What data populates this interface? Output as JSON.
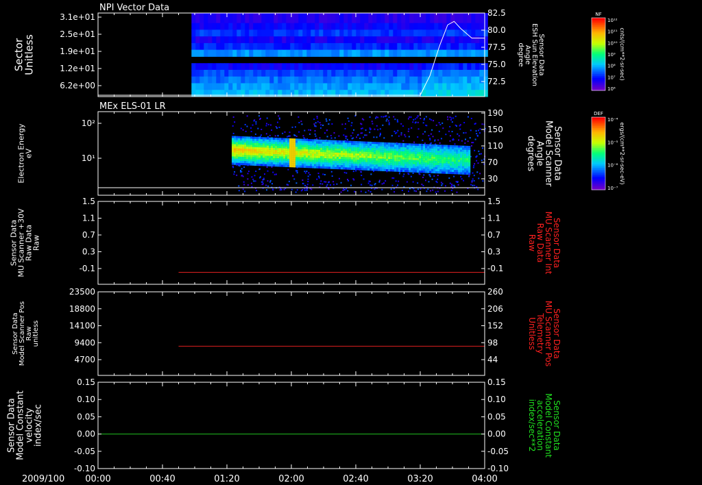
{
  "time_axis": {
    "date_label": "2009/100",
    "ticks": [
      "00:00",
      "00:40",
      "01:20",
      "02:00",
      "02:40",
      "03:20",
      "04:00"
    ]
  },
  "chart_data": [
    {
      "type": "heatmap",
      "title": "NPI Vector Data",
      "ylabel": "Sector\nUnitless",
      "y_ticks": [
        "3.1e+01",
        "2.5e+01",
        "1.9e+01",
        "1.2e+01",
        "6.2e+00"
      ],
      "right_ticks": [
        "82.5",
        "80.0",
        "77.5",
        "75.0",
        "72.5"
      ],
      "right_label": "Sensor Data\nESH Sun Elevation\nAngle\ndegree",
      "ylim_right": [
        70.5,
        82.5
      ],
      "data_start": "00:58",
      "overlay_line": {
        "name": "ESH Sun Elevation Angle",
        "x": [
          "00:00",
          "00:58",
          "03:20",
          "03:26",
          "03:32",
          "03:37",
          "03:41",
          "03:45",
          "03:52",
          "04:00"
        ],
        "y": [
          70.7,
          70.7,
          70.7,
          73.5,
          77.8,
          80.8,
          81.3,
          80.3,
          78.9,
          78.9
        ]
      },
      "colorbar": {
        "label": "NF",
        "units": "cnts/(cm**2-sr-sec)",
        "ticks": [
          "10¹²",
          "10¹¹",
          "10¹⁰",
          "10⁹",
          "10⁸",
          "10⁷",
          "10⁶"
        ]
      }
    },
    {
      "type": "heatmap",
      "title": "MEx ELS-01 LR",
      "ylabel": "Electron Energy\neV",
      "y_ticks": [
        "10²",
        "10¹"
      ],
      "right_ticks": [
        "190",
        "150",
        "110",
        "70",
        "30"
      ],
      "right_label": "Sensor Data\nModel Scanner\nAngle\ndegrees",
      "data_start": "01:23",
      "colorbar": {
        "label": "DEF",
        "units": "ergs/(cm**2-sr-sec-eV)",
        "ticks": [
          "10⁻⁴",
          "10⁻⁵",
          "10⁻⁶",
          "10⁻⁷"
        ]
      }
    },
    {
      "type": "line",
      "ylabel": "Sensor Data\nMU Scanner +30V\nRaw Data\nRaw",
      "y_ticks": [
        "1.5",
        "1.1",
        "0.7",
        "0.3",
        "-0.1"
      ],
      "ylim": [
        -0.3,
        1.5
      ],
      "right_ticks": [
        "1.5",
        "1.1",
        "0.7",
        "0.3",
        "-0.1"
      ],
      "right_label": "Sensor Data\nMU Scanner Int\nRaw Data\nRaw",
      "right_label_color": "#ff2020",
      "series": [
        {
          "color": "#e02020",
          "x": [
            "00:50",
            "04:00"
          ],
          "y": [
            -0.04,
            -0.04
          ]
        }
      ]
    },
    {
      "type": "line",
      "ylabel": "Sensor Data\nModel Scanner Pos\nRaw\nunitless",
      "y_ticks": [
        "23500",
        "18800",
        "14100",
        "9400",
        "4700"
      ],
      "ylim": [
        0,
        23500
      ],
      "right_ticks": [
        "260",
        "206",
        "152",
        "98",
        "44"
      ],
      "right_label": "Sensor Data\nMU Scanner Pos\nTelemetry\nUnitless",
      "right_label_color": "#ff2020",
      "series": [
        {
          "color": "#e02020",
          "x": [
            "00:50",
            "04:00"
          ],
          "y": [
            8200,
            8200
          ]
        }
      ]
    },
    {
      "type": "line",
      "ylabel": "Sensor Data\nModel Constant\nvelocity\nindex/sec",
      "y_ticks": [
        "0.15",
        "0.10",
        "0.05",
        "0.00",
        "-0.05",
        "-0.10"
      ],
      "ylim": [
        -0.1,
        0.15
      ],
      "right_ticks": [
        "0.15",
        "0.10",
        "0.05",
        "0.00",
        "-0.05",
        "-0.10"
      ],
      "right_label": "Sensor Data\nModel Constant\nacceleration\nindex/sec**2",
      "right_label_color": "#20e020",
      "series": [
        {
          "color": "#20c020",
          "x": [
            "00:00",
            "04:00"
          ],
          "y": [
            0.0,
            0.0
          ]
        }
      ]
    }
  ]
}
